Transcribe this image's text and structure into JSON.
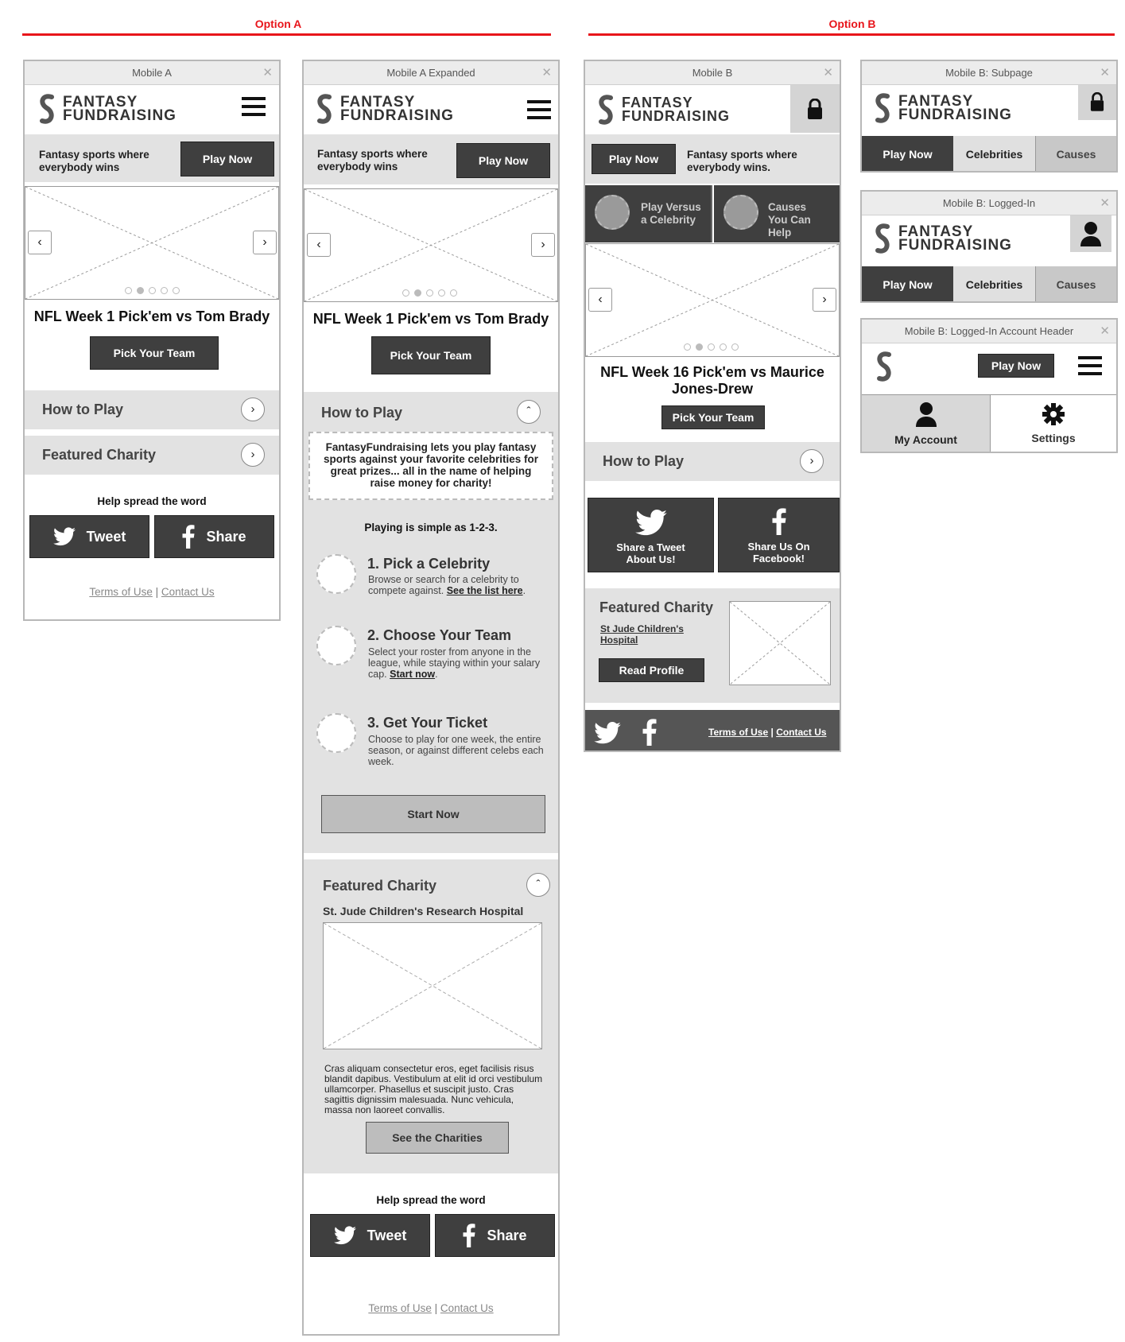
{
  "options": {
    "a": "Option A",
    "b": "Option B"
  },
  "brand": {
    "line1": "FANTASY",
    "line2": "FUNDRAISING",
    "accent": "#e8151b"
  },
  "common": {
    "play_now": "Play Now",
    "pick_team": "Pick Your Team",
    "how_to_play": "How to Play",
    "featured_charity": "Featured Charity",
    "help_spread": "Help spread the word",
    "tweet": "Tweet",
    "share": "Share",
    "terms": "Terms of Use",
    "contact": "Contact Us",
    "sep": "|"
  },
  "mobile_a": {
    "title": "Mobile A",
    "close": "✕",
    "tagline": "Fantasy sports where everybody wins",
    "heading": "NFL Week 1 Pick'em vs Tom Brady"
  },
  "mobile_a_expanded": {
    "title": "Mobile A Expanded",
    "close": "✕",
    "tagline": "Fantasy sports where everybody wins",
    "heading": "NFL Week 1 Pick'em vs Tom Brady",
    "intro": "FantasyFundraising lets you play fantasy sports against your favorite celebrities for great prizes... all in the name of helping raise money for charity!",
    "simple": "Playing is simple as 1-2-3.",
    "step1_title": "1. Pick a Celebrity",
    "step1_text": "Browse or search for a celebrity to compete against.",
    "step1_link": "See the list here",
    "step2_title": "2. Choose Your Team",
    "step2_text": "Select your roster from anyone in the league, while staying within your salary cap.",
    "step2_link": "Start now",
    "step3_title": "3. Get Your Ticket",
    "step3_text": "Choose to play for one week, the entire season, or against different celebs each week.",
    "start_now": "Start Now",
    "charity_name": "St. Jude Children's Research Hospital",
    "charity_text": "Cras aliquam consectetur eros, eget facilisis risus blandit dapibus. Vestibulum at elit id orci vestibulum ullamcorper. Phasellus et suscipit justo. Cras sagittis dignissim malesuada. Nunc vehicula, massa non laoreet convallis.",
    "see_charities": "See the Charities"
  },
  "mobile_b": {
    "title": "Mobile B",
    "close": "✕",
    "tagline": "Fantasy sports where everybody wins.",
    "play_versus": "Play Versus a Celebrity",
    "causes": "Causes You Can Help",
    "heading": "NFL Week 16 Pick'em vs Maurice Jones-Drew",
    "share_tweet": "Share a Tweet About Us!",
    "share_fb": "Share Us On Facebook!",
    "charity_link": "St Jude Children's Hospital",
    "read_profile": "Read Profile"
  },
  "mobile_b_subpage": {
    "title": "Mobile B: Subpage",
    "close": "✕"
  },
  "mobile_b_loggedin": {
    "title": "Mobile B: Logged-In",
    "close": "✕"
  },
  "mobile_b_account": {
    "title": "Mobile B: Logged-In Account Header",
    "close": "✕",
    "my_account": "My Account",
    "settings": "Settings"
  },
  "tabs": {
    "celebrities": "Celebrities",
    "causes": "Causes"
  }
}
